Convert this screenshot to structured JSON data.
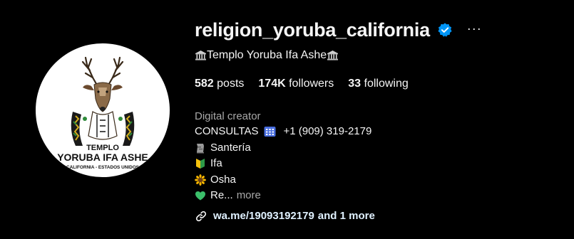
{
  "profile": {
    "username": "religion_yoruba_california",
    "verified_icon": "verified-badge-icon",
    "more_options": "···",
    "full_name": "Templo Yoruba Ifa Ashe",
    "stats": {
      "posts_count": "582",
      "posts_label": "posts",
      "followers_count": "174K",
      "followers_label": "followers",
      "following_count": "33",
      "following_label": "following"
    },
    "category": "Digital creator",
    "bio": {
      "line1_text": "CONSULTAS",
      "line1_phone": "+1 (909) 319-2179",
      "line2": "Santería",
      "line3": "Ifa",
      "line4": "Osha",
      "line5": "Re...",
      "more_label": "more"
    },
    "link": {
      "url_text": "wa.me/19093192179",
      "extra": "and 1 more"
    },
    "avatar": {
      "logo_line1": "TEMPLO",
      "logo_line2": "YORUBA IFA ASHE",
      "logo_line3": "CALIFORNIA - ESTADOS UNIDOS"
    }
  },
  "colors": {
    "background": "#000000",
    "text_primary": "#f5f5f5",
    "text_secondary": "#a8a8a8",
    "verified_blue": "#0095f6",
    "link": "#e0f1ff"
  }
}
